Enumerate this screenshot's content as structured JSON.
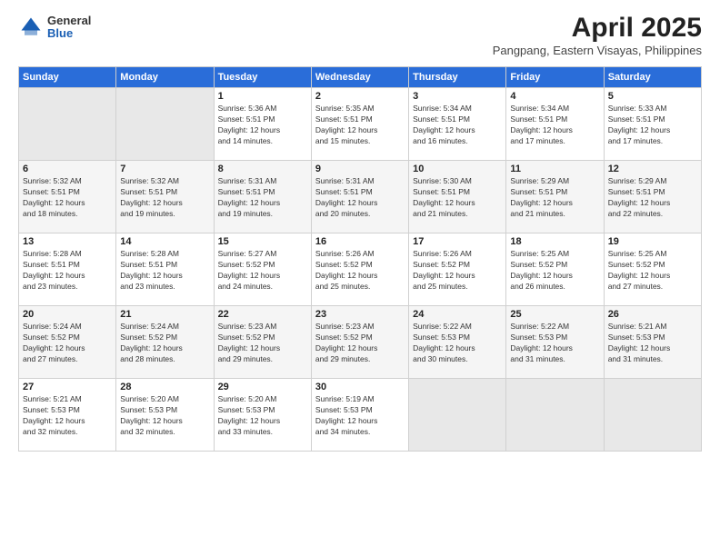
{
  "header": {
    "logo_general": "General",
    "logo_blue": "Blue",
    "title": "April 2025",
    "subtitle": "Pangpang, Eastern Visayas, Philippines"
  },
  "days_of_week": [
    "Sunday",
    "Monday",
    "Tuesday",
    "Wednesday",
    "Thursday",
    "Friday",
    "Saturday"
  ],
  "weeks": [
    [
      {
        "day": "",
        "info": ""
      },
      {
        "day": "",
        "info": ""
      },
      {
        "day": "1",
        "info": "Sunrise: 5:36 AM\nSunset: 5:51 PM\nDaylight: 12 hours\nand 14 minutes."
      },
      {
        "day": "2",
        "info": "Sunrise: 5:35 AM\nSunset: 5:51 PM\nDaylight: 12 hours\nand 15 minutes."
      },
      {
        "day": "3",
        "info": "Sunrise: 5:34 AM\nSunset: 5:51 PM\nDaylight: 12 hours\nand 16 minutes."
      },
      {
        "day": "4",
        "info": "Sunrise: 5:34 AM\nSunset: 5:51 PM\nDaylight: 12 hours\nand 17 minutes."
      },
      {
        "day": "5",
        "info": "Sunrise: 5:33 AM\nSunset: 5:51 PM\nDaylight: 12 hours\nand 17 minutes."
      }
    ],
    [
      {
        "day": "6",
        "info": "Sunrise: 5:32 AM\nSunset: 5:51 PM\nDaylight: 12 hours\nand 18 minutes."
      },
      {
        "day": "7",
        "info": "Sunrise: 5:32 AM\nSunset: 5:51 PM\nDaylight: 12 hours\nand 19 minutes."
      },
      {
        "day": "8",
        "info": "Sunrise: 5:31 AM\nSunset: 5:51 PM\nDaylight: 12 hours\nand 19 minutes."
      },
      {
        "day": "9",
        "info": "Sunrise: 5:31 AM\nSunset: 5:51 PM\nDaylight: 12 hours\nand 20 minutes."
      },
      {
        "day": "10",
        "info": "Sunrise: 5:30 AM\nSunset: 5:51 PM\nDaylight: 12 hours\nand 21 minutes."
      },
      {
        "day": "11",
        "info": "Sunrise: 5:29 AM\nSunset: 5:51 PM\nDaylight: 12 hours\nand 21 minutes."
      },
      {
        "day": "12",
        "info": "Sunrise: 5:29 AM\nSunset: 5:51 PM\nDaylight: 12 hours\nand 22 minutes."
      }
    ],
    [
      {
        "day": "13",
        "info": "Sunrise: 5:28 AM\nSunset: 5:51 PM\nDaylight: 12 hours\nand 23 minutes."
      },
      {
        "day": "14",
        "info": "Sunrise: 5:28 AM\nSunset: 5:51 PM\nDaylight: 12 hours\nand 23 minutes."
      },
      {
        "day": "15",
        "info": "Sunrise: 5:27 AM\nSunset: 5:52 PM\nDaylight: 12 hours\nand 24 minutes."
      },
      {
        "day": "16",
        "info": "Sunrise: 5:26 AM\nSunset: 5:52 PM\nDaylight: 12 hours\nand 25 minutes."
      },
      {
        "day": "17",
        "info": "Sunrise: 5:26 AM\nSunset: 5:52 PM\nDaylight: 12 hours\nand 25 minutes."
      },
      {
        "day": "18",
        "info": "Sunrise: 5:25 AM\nSunset: 5:52 PM\nDaylight: 12 hours\nand 26 minutes."
      },
      {
        "day": "19",
        "info": "Sunrise: 5:25 AM\nSunset: 5:52 PM\nDaylight: 12 hours\nand 27 minutes."
      }
    ],
    [
      {
        "day": "20",
        "info": "Sunrise: 5:24 AM\nSunset: 5:52 PM\nDaylight: 12 hours\nand 27 minutes."
      },
      {
        "day": "21",
        "info": "Sunrise: 5:24 AM\nSunset: 5:52 PM\nDaylight: 12 hours\nand 28 minutes."
      },
      {
        "day": "22",
        "info": "Sunrise: 5:23 AM\nSunset: 5:52 PM\nDaylight: 12 hours\nand 29 minutes."
      },
      {
        "day": "23",
        "info": "Sunrise: 5:23 AM\nSunset: 5:52 PM\nDaylight: 12 hours\nand 29 minutes."
      },
      {
        "day": "24",
        "info": "Sunrise: 5:22 AM\nSunset: 5:53 PM\nDaylight: 12 hours\nand 30 minutes."
      },
      {
        "day": "25",
        "info": "Sunrise: 5:22 AM\nSunset: 5:53 PM\nDaylight: 12 hours\nand 31 minutes."
      },
      {
        "day": "26",
        "info": "Sunrise: 5:21 AM\nSunset: 5:53 PM\nDaylight: 12 hours\nand 31 minutes."
      }
    ],
    [
      {
        "day": "27",
        "info": "Sunrise: 5:21 AM\nSunset: 5:53 PM\nDaylight: 12 hours\nand 32 minutes."
      },
      {
        "day": "28",
        "info": "Sunrise: 5:20 AM\nSunset: 5:53 PM\nDaylight: 12 hours\nand 32 minutes."
      },
      {
        "day": "29",
        "info": "Sunrise: 5:20 AM\nSunset: 5:53 PM\nDaylight: 12 hours\nand 33 minutes."
      },
      {
        "day": "30",
        "info": "Sunrise: 5:19 AM\nSunset: 5:53 PM\nDaylight: 12 hours\nand 34 minutes."
      },
      {
        "day": "",
        "info": ""
      },
      {
        "day": "",
        "info": ""
      },
      {
        "day": "",
        "info": ""
      }
    ]
  ]
}
